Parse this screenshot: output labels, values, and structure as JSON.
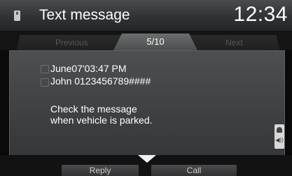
{
  "header": {
    "title": "Text message",
    "clock": "12:34",
    "icon": "phone-icon"
  },
  "tabs": {
    "previous": "Previous",
    "position": "5/10",
    "next": "Next"
  },
  "message": {
    "date_time": "June07'03:47 PM",
    "sender": "John 0123456789####",
    "body_line1": "Check the message",
    "body_line2": "when vehicle is parked."
  },
  "actions": {
    "reply": "Reply",
    "call": "Call"
  },
  "colors": {
    "text": "#ffffff",
    "panel": "#404244",
    "background": "#0a0a0a"
  }
}
